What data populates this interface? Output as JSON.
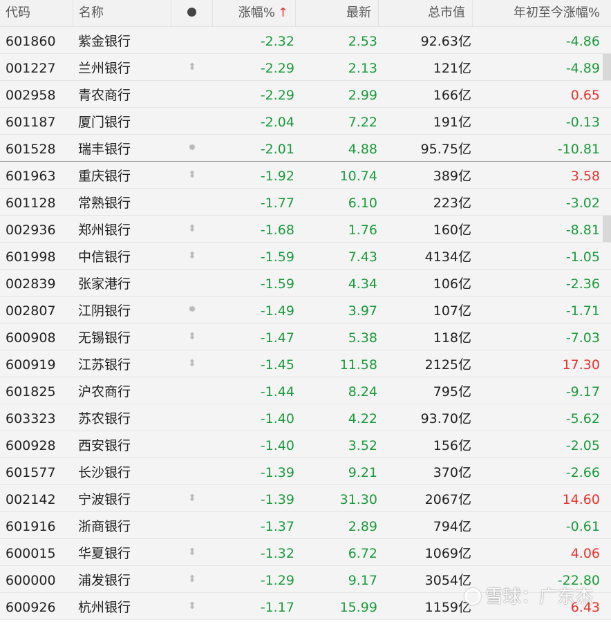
{
  "header": {
    "code": "代码",
    "name": "名称",
    "change_pct": "涨幅%",
    "sort_arrow": "↑",
    "last": "最新",
    "market_cap": "总市值",
    "ytd_change": "年初至今涨幅%"
  },
  "icons": {
    "dot": "dot-icon",
    "swap": "up-down-arrow-icon",
    "star": "sparkle-icon",
    "sort": "sort-ascending-arrow-icon"
  },
  "colors": {
    "down": "#1a9a3a",
    "up": "#e8312b"
  },
  "rows": [
    {
      "code": "601860",
      "name": "紫金银行",
      "mark": "",
      "chg": "-2.32",
      "last": "2.53",
      "cap": "92.63亿",
      "ytd": "-4.86",
      "ytd_color": "green"
    },
    {
      "code": "001227",
      "name": "兰州银行",
      "mark": "swap",
      "chg": "-2.29",
      "last": "2.13",
      "cap": "121亿",
      "ytd": "-4.89",
      "ytd_color": "green"
    },
    {
      "code": "002958",
      "name": "青农商行",
      "mark": "",
      "chg": "-2.29",
      "last": "2.99",
      "cap": "166亿",
      "ytd": "0.65",
      "ytd_color": "red"
    },
    {
      "code": "601187",
      "name": "厦门银行",
      "mark": "",
      "chg": "-2.04",
      "last": "7.22",
      "cap": "191亿",
      "ytd": "-0.13",
      "ytd_color": "green"
    },
    {
      "code": "601528",
      "name": "瑞丰银行",
      "mark": "star",
      "chg": "-2.01",
      "last": "4.88",
      "cap": "95.75亿",
      "ytd": "-10.81",
      "ytd_color": "green"
    },
    {
      "code": "601963",
      "name": "重庆银行",
      "mark": "swap",
      "chg": "-1.92",
      "last": "10.74",
      "cap": "389亿",
      "ytd": "3.58",
      "ytd_color": "red"
    },
    {
      "code": "601128",
      "name": "常熟银行",
      "mark": "",
      "chg": "-1.77",
      "last": "6.10",
      "cap": "223亿",
      "ytd": "-3.02",
      "ytd_color": "green"
    },
    {
      "code": "002936",
      "name": "郑州银行",
      "mark": "swap",
      "chg": "-1.68",
      "last": "1.76",
      "cap": "160亿",
      "ytd": "-8.81",
      "ytd_color": "green"
    },
    {
      "code": "601998",
      "name": "中信银行",
      "mark": "swap",
      "chg": "-1.59",
      "last": "7.43",
      "cap": "4134亿",
      "ytd": "-1.05",
      "ytd_color": "green"
    },
    {
      "code": "002839",
      "name": "张家港行",
      "mark": "",
      "chg": "-1.59",
      "last": "4.34",
      "cap": "106亿",
      "ytd": "-2.36",
      "ytd_color": "green"
    },
    {
      "code": "002807",
      "name": "江阴银行",
      "mark": "star",
      "chg": "-1.49",
      "last": "3.97",
      "cap": "107亿",
      "ytd": "-1.71",
      "ytd_color": "green"
    },
    {
      "code": "600908",
      "name": "无锡银行",
      "mark": "swap",
      "chg": "-1.47",
      "last": "5.38",
      "cap": "118亿",
      "ytd": "-7.03",
      "ytd_color": "green"
    },
    {
      "code": "600919",
      "name": "江苏银行",
      "mark": "swap",
      "chg": "-1.45",
      "last": "11.58",
      "cap": "2125亿",
      "ytd": "17.30",
      "ytd_color": "red"
    },
    {
      "code": "601825",
      "name": "沪农商行",
      "mark": "",
      "chg": "-1.44",
      "last": "8.24",
      "cap": "795亿",
      "ytd": "-9.17",
      "ytd_color": "green"
    },
    {
      "code": "603323",
      "name": "苏农银行",
      "mark": "",
      "chg": "-1.40",
      "last": "4.22",
      "cap": "93.70亿",
      "ytd": "-5.62",
      "ytd_color": "green"
    },
    {
      "code": "600928",
      "name": "西安银行",
      "mark": "",
      "chg": "-1.40",
      "last": "3.52",
      "cap": "156亿",
      "ytd": "-2.05",
      "ytd_color": "green"
    },
    {
      "code": "601577",
      "name": "长沙银行",
      "mark": "",
      "chg": "-1.39",
      "last": "9.21",
      "cap": "370亿",
      "ytd": "-2.66",
      "ytd_color": "green"
    },
    {
      "code": "002142",
      "name": "宁波银行",
      "mark": "swap",
      "chg": "-1.39",
      "last": "31.30",
      "cap": "2067亿",
      "ytd": "14.60",
      "ytd_color": "red"
    },
    {
      "code": "601916",
      "name": "浙商银行",
      "mark": "",
      "chg": "-1.37",
      "last": "2.89",
      "cap": "794亿",
      "ytd": "-0.61",
      "ytd_color": "green"
    },
    {
      "code": "600015",
      "name": "华夏银行",
      "mark": "swap",
      "chg": "-1.32",
      "last": "6.72",
      "cap": "1069亿",
      "ytd": "4.06",
      "ytd_color": "red"
    },
    {
      "code": "600000",
      "name": "浦发银行",
      "mark": "swap",
      "chg": "-1.29",
      "last": "9.17",
      "cap": "3054亿",
      "ytd": "-22.80",
      "ytd_color": "green"
    },
    {
      "code": "600926",
      "name": "杭州银行",
      "mark": "swap",
      "chg": "-1.17",
      "last": "15.99",
      "cap": "1159亿",
      "ytd": "6.43",
      "ytd_color": "red"
    }
  ],
  "watermark": {
    "text": "雪球：广东杰"
  }
}
